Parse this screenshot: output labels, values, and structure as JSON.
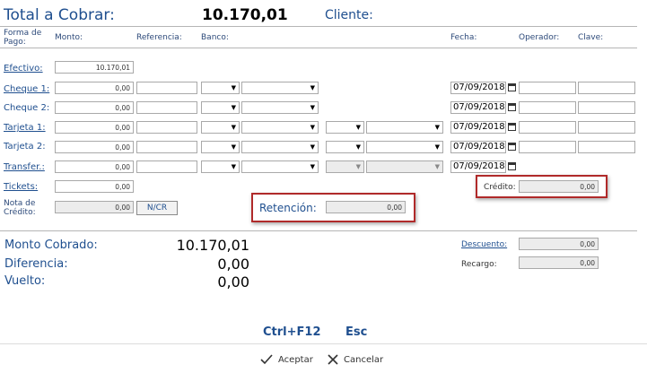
{
  "header": {
    "title": "Total a Cobrar:",
    "total": "10.170,01",
    "cliente_label": "Cliente:"
  },
  "columns": {
    "forma_de_pago": "Forma de Pago:",
    "monto": "Monto:",
    "referencia": "Referencia:",
    "banco": "Banco:",
    "fecha": "Fecha:",
    "operador": "Operador:",
    "clave": "Clave:"
  },
  "rows": {
    "efectivo": {
      "label": "Efectivo:",
      "monto": "10.170,01"
    },
    "cheque1": {
      "label": "Cheque 1:",
      "monto": "0,00",
      "fecha": "07/09/2018"
    },
    "cheque2": {
      "label": "Cheque 2:",
      "monto": "0,00",
      "fecha": "07/09/2018"
    },
    "tarjeta1": {
      "label": "Tarjeta 1:",
      "monto": "0,00",
      "fecha": "07/09/2018"
    },
    "tarjeta2": {
      "label": "Tarjeta 2:",
      "monto": "0,00",
      "fecha": "07/09/2018"
    },
    "transfer": {
      "label": "Transfer.:",
      "monto": "0,00",
      "fecha": "07/09/2018"
    },
    "tickets": {
      "label": "Tickets:",
      "monto": "0,00"
    },
    "nota_credito": {
      "label": "Nota de Crédito:",
      "monto": "0,00",
      "button": "N/CR"
    }
  },
  "credito": {
    "label": "Crédito:",
    "value": "0,00"
  },
  "retencion": {
    "label": "Retención:",
    "value": "0,00"
  },
  "summary": {
    "monto_cobrado_label": "Monto Cobrado:",
    "monto_cobrado": "10.170,01",
    "diferencia_label": "Diferencia:",
    "diferencia": "0,00",
    "vuelto_label": "Vuelto:",
    "vuelto": "0,00"
  },
  "descuento": {
    "label": "Descuento:",
    "value": "0,00"
  },
  "recargo": {
    "label": "Recargo:",
    "value": "0,00"
  },
  "shortcuts": {
    "accept_key": "Ctrl+F12",
    "cancel_key": "Esc"
  },
  "footer": {
    "accept_label": "Aceptar",
    "cancel_label": "Cancelar"
  },
  "colors": {
    "accent": "#1f4f8f",
    "highlight_border": "#b02a2a"
  }
}
